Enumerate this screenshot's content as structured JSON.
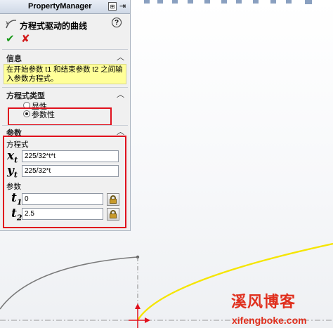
{
  "property_manager": {
    "title": "PropertyManager",
    "pin_label": "⊞",
    "feature_title": "方程式驱动的曲线",
    "help_icon": "?",
    "ok_symbol": "✔",
    "cancel_symbol": "✘"
  },
  "info_section": {
    "header": "信息",
    "message": "在开始参数 t1 和结束参数 t2 之间输入参数方程式。"
  },
  "equation_type_section": {
    "header": "方程式类型",
    "options": [
      {
        "label": "显性",
        "selected": false
      },
      {
        "label": "参数性",
        "selected": true
      }
    ]
  },
  "parameters_section": {
    "header": "参数",
    "equation_label": "方程式",
    "xt": {
      "var": "x",
      "sub": "t",
      "value": "225/32*t*t"
    },
    "yt": {
      "var": "y",
      "sub": "t",
      "value": "225/32*t"
    },
    "params_label": "参数",
    "t1": {
      "var": "t",
      "sub": "1",
      "value": "0"
    },
    "t2": {
      "var": "t",
      "sub": "2",
      "value": "2.5"
    }
  },
  "colors": {
    "highlight_box": "#e0101c",
    "info_background": "#ffff99",
    "curve": "#f5e500",
    "sketch_line": "#707070",
    "origin": "#e0101c",
    "watermark": "#e0301e"
  },
  "watermark": {
    "line1": "溪风博客",
    "line2": "xifengboke.com"
  }
}
